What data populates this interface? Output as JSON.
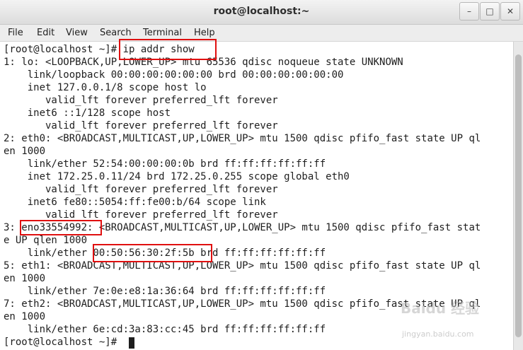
{
  "window": {
    "title": "root@localhost:~",
    "minimize_glyph": "–",
    "maximize_glyph": "□",
    "close_glyph": "✕"
  },
  "menu": [
    "File",
    "Edit",
    "View",
    "Search",
    "Terminal",
    "Help"
  ],
  "terminal": {
    "lines": [
      "[root@localhost ~]# ip addr show",
      "1: lo: <LOOPBACK,UP,LOWER_UP> mtu 65536 qdisc noqueue state UNKNOWN",
      "    link/loopback 00:00:00:00:00:00 brd 00:00:00:00:00:00",
      "    inet 127.0.0.1/8 scope host lo",
      "       valid_lft forever preferred_lft forever",
      "    inet6 ::1/128 scope host",
      "       valid_lft forever preferred_lft forever",
      "2: eth0: <BROADCAST,MULTICAST,UP,LOWER_UP> mtu 1500 qdisc pfifo_fast state UP ql",
      "en 1000",
      "    link/ether 52:54:00:00:00:0b brd ff:ff:ff:ff:ff:ff",
      "    inet 172.25.0.11/24 brd 172.25.0.255 scope global eth0",
      "       valid_lft forever preferred_lft forever",
      "    inet6 fe80::5054:ff:fe00:b/64 scope link",
      "       valid_lft forever preferred_lft forever",
      "3: eno33554992: <BROADCAST,MULTICAST,UP,LOWER_UP> mtu 1500 qdisc pfifo_fast stat",
      "e UP qlen 1000",
      "    link/ether 00:50:56:30:2f:5b brd ff:ff:ff:ff:ff:ff",
      "5: eth1: <BROADCAST,MULTICAST,UP,LOWER_UP> mtu 1500 qdisc pfifo_fast state UP ql",
      "en 1000",
      "    link/ether 7e:0e:e8:1a:36:64 brd ff:ff:ff:ff:ff:ff",
      "7: eth2: <BROADCAST,MULTICAST,UP,LOWER_UP> mtu 1500 qdisc pfifo_fast state UP ql",
      "en 1000",
      "    link/ether 6e:cd:3a:83:cc:45 brd ff:ff:ff:ff:ff:ff",
      "[root@localhost ~]# "
    ]
  },
  "annotations": {
    "color": "#e01010"
  },
  "watermark": {
    "text": "Baidu 经验",
    "sub": "jingyan.baidu.com"
  }
}
